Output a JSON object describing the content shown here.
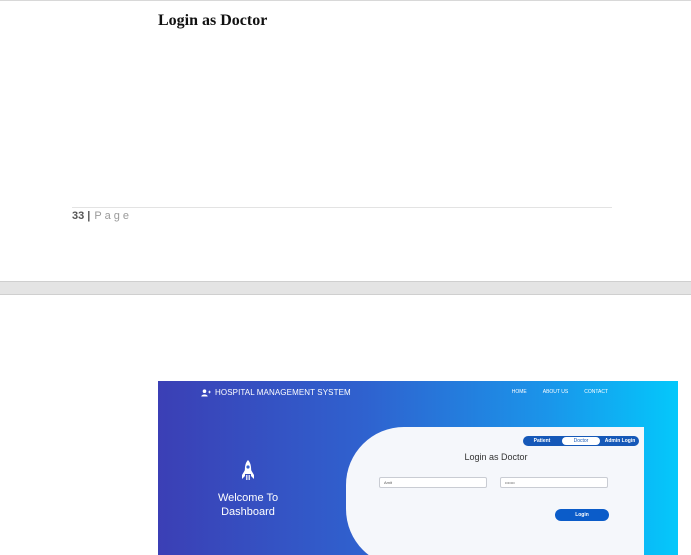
{
  "document": {
    "heading": "Login as Doctor",
    "footer": {
      "page_number": "33",
      "separator": "|",
      "page_label": "Page"
    }
  },
  "screenshot": {
    "brand": {
      "title": "HOSPITAL MANAGEMENT SYSTEM",
      "icon": "user-plus-icon"
    },
    "nav": [
      "HOME",
      "ABOUT US",
      "CONTACT"
    ],
    "hero": {
      "icon": "rocket-icon",
      "line1": "Welcome To",
      "line2": "Dashboard"
    },
    "tabs": [
      "Patient",
      "Doctor",
      "Admin Login"
    ],
    "active_tab": "Doctor",
    "form": {
      "title": "Login as Doctor",
      "username_value": "Amit",
      "password_value": "•••••••",
      "login_label": "Login"
    },
    "colors": {
      "gradient_start": "#3b3fb5",
      "gradient_end": "#04c8fb",
      "accent": "#1558b8"
    }
  }
}
